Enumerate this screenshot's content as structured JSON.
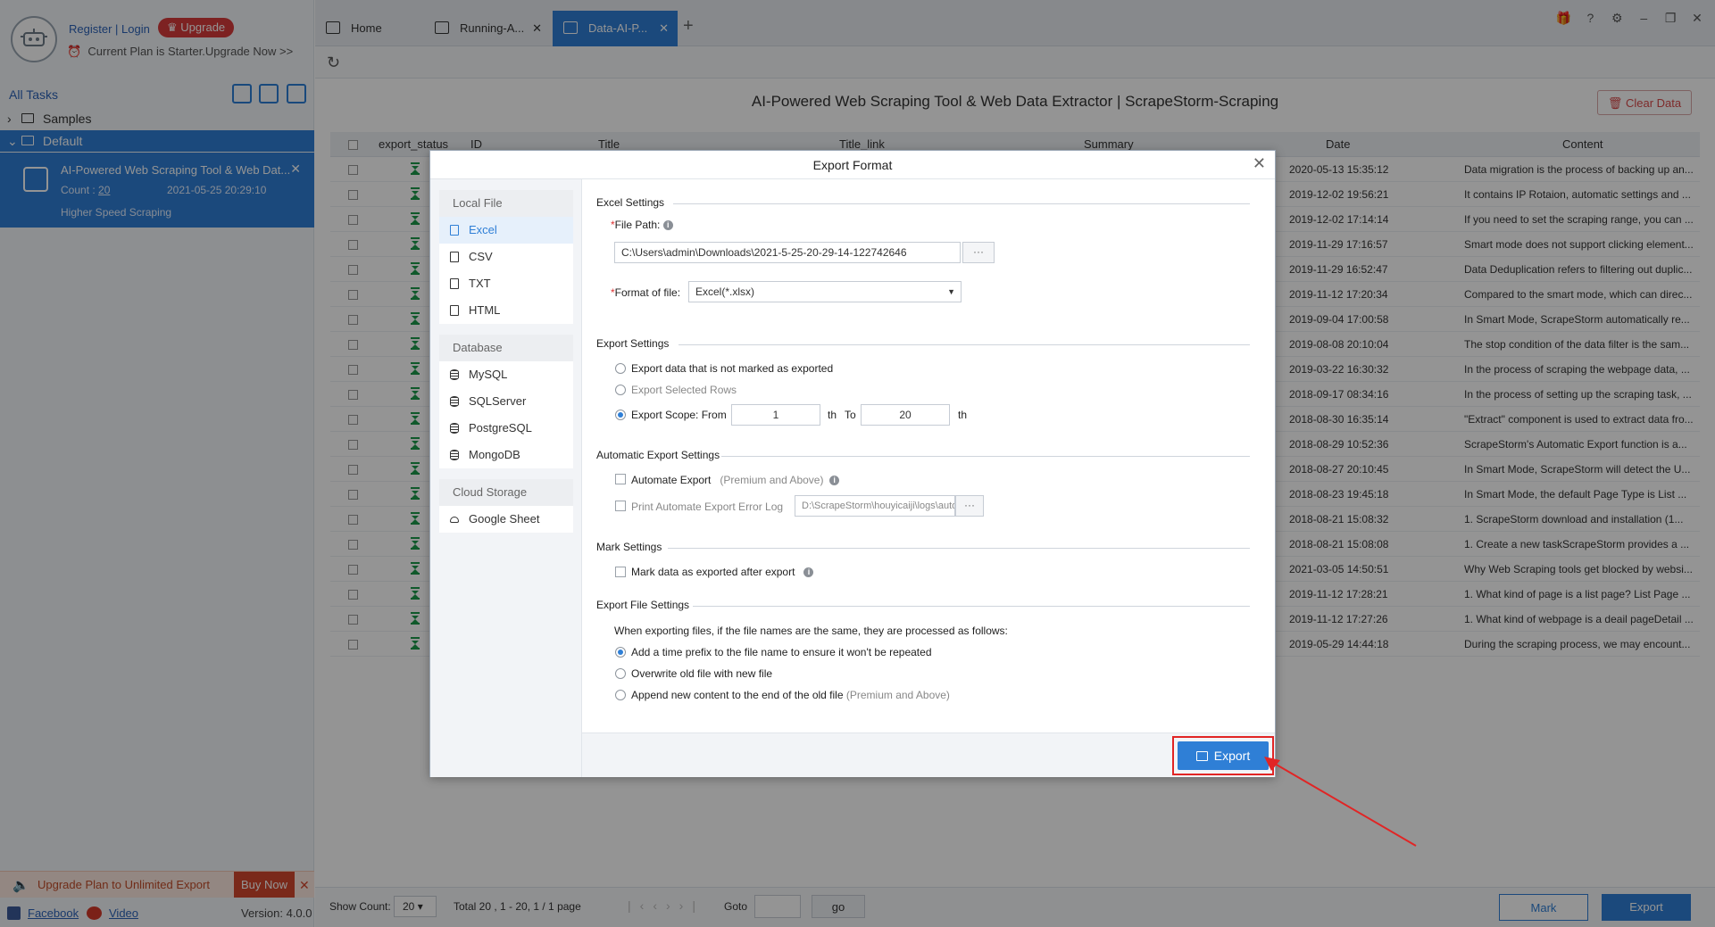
{
  "sidebar": {
    "register_login": "Register | Login",
    "upgrade_badge": "Upgrade",
    "plan_text": "Current Plan is Starter.Upgrade Now >>",
    "all_tasks": "All Tasks",
    "tree": [
      {
        "label": "Samples"
      },
      {
        "label": "Default"
      }
    ],
    "task": {
      "title": "AI-Powered Web Scraping Tool & Web Dat...",
      "count_label": "Count :",
      "count_value": "20",
      "date": "2021-05-25 20:29:10",
      "speed_link": "Higher Speed Scraping"
    },
    "upgrade_bar_text": "Upgrade Plan to Unlimited Export",
    "buy_now": "Buy Now",
    "facebook": "Facebook",
    "video": "Video",
    "version": "Version: 4.0.0"
  },
  "tabs": [
    {
      "label": "Home"
    },
    {
      "label": "Running-A..."
    },
    {
      "label": "Data-AI-P..."
    }
  ],
  "page_title": "AI-Powered Web Scraping Tool & Web Data Extractor | ScrapeStorm-Scraping",
  "clear_data": "Clear Data",
  "table": {
    "headers": [
      "export_status",
      "ID",
      "Title",
      "Title_link",
      "Summary",
      "Date",
      "Content"
    ],
    "rows": [
      {
        "date": "2020-05-13 15:35:12",
        "content": "Data migration is the process of backing up an..."
      },
      {
        "date": "2019-12-02 19:56:21",
        "content": "It contains IP Rotaion, automatic settings and ..."
      },
      {
        "date": "2019-12-02 17:14:14",
        "content": "If you need to set the scraping range, you can ..."
      },
      {
        "date": "2019-11-29 17:16:57",
        "content": "Smart mode does not support clicking element..."
      },
      {
        "date": "2019-11-29 16:52:47",
        "content": "Data Deduplication refers to filtering out duplic..."
      },
      {
        "date": "2019-11-12 17:20:34",
        "content": "Compared to the smart mode, which can direc..."
      },
      {
        "date": "2019-09-04 17:00:58",
        "content": "In Smart Mode, ScrapeStorm automatically re..."
      },
      {
        "date": "2019-08-08 20:10:04",
        "content": "The stop condition of the data filter is the sam..."
      },
      {
        "date": "2019-03-22 16:30:32",
        "content": "In the process of scraping the webpage data, ..."
      },
      {
        "date": "2018-09-17 08:34:16",
        "content": "In the process of setting up the scraping task, ..."
      },
      {
        "date": "2018-08-30 16:35:14",
        "content": "\"Extract\" component is used to extract data fro..."
      },
      {
        "date": "2018-08-29 10:52:36",
        "content": "ScrapeStorm's Automatic Export function is a..."
      },
      {
        "date": "2018-08-27 20:10:45",
        "content": "In Smart Mode, ScrapeStorm will detect the U..."
      },
      {
        "date": "2018-08-23 19:45:18",
        "content": "In Smart Mode, the default Page Type is List ..."
      },
      {
        "date": "2018-08-21 15:08:32",
        "content": "1. ScrapeStorm download and installation  (1..."
      },
      {
        "date": "2018-08-21 15:08:08",
        "content": "1. Create a new taskScrapeStorm provides a ..."
      },
      {
        "date": "2021-03-05 14:50:51",
        "content": "Why Web Scraping tools get blocked by websi..."
      },
      {
        "date": "2019-11-12 17:28:21",
        "content": "1. What kind of page is a list page?  List Page ..."
      },
      {
        "date": "2019-11-12 17:27:26",
        "content": "1. What kind of webpage is a deail pageDetail ..."
      },
      {
        "date": "2019-05-29 14:44:18",
        "content": "During the scraping process, we may encount..."
      }
    ]
  },
  "pagination": {
    "show_count_label": "Show Count:",
    "show_count_value": "20",
    "total_text": "Total  20 ,  1  - 20,  1  /  1   page",
    "goto_label": "Goto",
    "go_button": "go",
    "mark_button": "Mark",
    "export_button": "Export"
  },
  "modal": {
    "title": "Export Format",
    "left": {
      "local_file_title": "Local File",
      "local_file_items": [
        "Excel",
        "CSV",
        "TXT",
        "HTML"
      ],
      "database_title": "Database",
      "database_items": [
        "MySQL",
        "SQLServer",
        "PostgreSQL",
        "MongoDB"
      ],
      "cloud_title": "Cloud Storage",
      "cloud_items": [
        "Google Sheet"
      ]
    },
    "excel_settings": {
      "heading": "Excel Settings",
      "file_path_label": "File Path:",
      "file_path_value": "C:\\Users\\admin\\Downloads\\2021-5-25-20-29-14-122742646",
      "browse": "···",
      "format_label": "Format of file:",
      "format_value": "Excel(*.xlsx)"
    },
    "export_settings": {
      "heading": "Export Settings",
      "opt_not_marked": "Export data that is not marked as exported",
      "opt_selected_rows": "Export Selected Rows",
      "opt_scope": "Export Scope: From",
      "from_value": "1",
      "th1": "th",
      "to_label": "To",
      "to_value": "20",
      "th2": "th"
    },
    "auto_export": {
      "heading": "Automatic Export Settings",
      "automate_label": "Automate Export",
      "automate_note": "(Premium and Above)",
      "print_log_label": "Print Automate Export Error Log",
      "log_path": "D:\\ScrapeStorm\\houyicaiji\\logs\\auto_e",
      "browse": "···"
    },
    "mark_settings": {
      "heading": "Mark Settings",
      "mark_label": "Mark data as exported after export"
    },
    "file_settings": {
      "heading": "Export File Settings",
      "description": "When exporting files, if the file names are the same, they are processed as follows:",
      "opt_prefix": "Add a time prefix to the file name to ensure it won't be repeated",
      "opt_overwrite": "Overwrite old file with new file",
      "opt_append": "Append new content to the end of the old file",
      "opt_append_note": "(Premium and Above)"
    },
    "export_button": "Export"
  },
  "colors": {
    "accent": "#2f7fd6",
    "highlight": "#e12525",
    "status_green": "#1d9a4b"
  }
}
